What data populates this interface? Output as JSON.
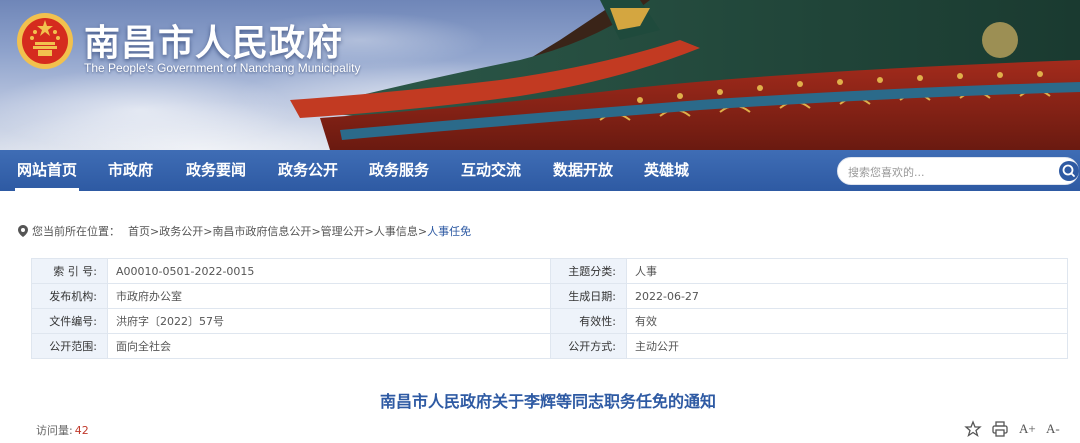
{
  "header": {
    "site_title": "南昌市人民政府",
    "site_subtitle": "The People's Government of Nanchang Municipality",
    "emblem_icon": "national-emblem-icon"
  },
  "nav": {
    "items": [
      {
        "label": "网站首页",
        "active": true
      },
      {
        "label": "市政府"
      },
      {
        "label": "政务要闻"
      },
      {
        "label": "政务公开"
      },
      {
        "label": "政务服务"
      },
      {
        "label": "互动交流"
      },
      {
        "label": "数据开放"
      },
      {
        "label": "英雄城"
      }
    ],
    "search": {
      "placeholder": "搜索您喜欢的...",
      "button_icon": "search-icon"
    }
  },
  "breadcrumb": {
    "label": "您当前所在位置：",
    "items": [
      "首页",
      "政务公开",
      "南昌市政府信息公开",
      "管理公开",
      "人事信息",
      "人事任免"
    ],
    "separator": ">"
  },
  "info": {
    "rows": [
      {
        "label1": "索 引 号:",
        "value1": "A00010-0501-2022-0015",
        "label2": "主题分类:",
        "value2": "人事"
      },
      {
        "label1": "发布机构:",
        "value1": "市政府办公室",
        "label2": "生成日期:",
        "value2": "2022-06-27"
      },
      {
        "label1": "文件编号:",
        "value1": "洪府字〔2022〕57号",
        "label2": "有效性:",
        "value2": "有效"
      },
      {
        "label1": "公开范围:",
        "value1": "面向全社会",
        "label2": "公开方式:",
        "value2": "主动公开"
      }
    ]
  },
  "article": {
    "title": "南昌市人民政府关于李辉等同志职务任免的通知",
    "visits_label": "访问量:",
    "visits_count": "42"
  },
  "tools": {
    "print_icon": "print-icon",
    "font_increase_label": "A+",
    "font_decrease_label": "A-",
    "star_icon": "star-icon"
  },
  "colors": {
    "nav_blue": "#2e5aa3",
    "title_blue": "#2e5aa3",
    "label_bg": "#eef3fa",
    "visits_red": "#c0392b"
  }
}
